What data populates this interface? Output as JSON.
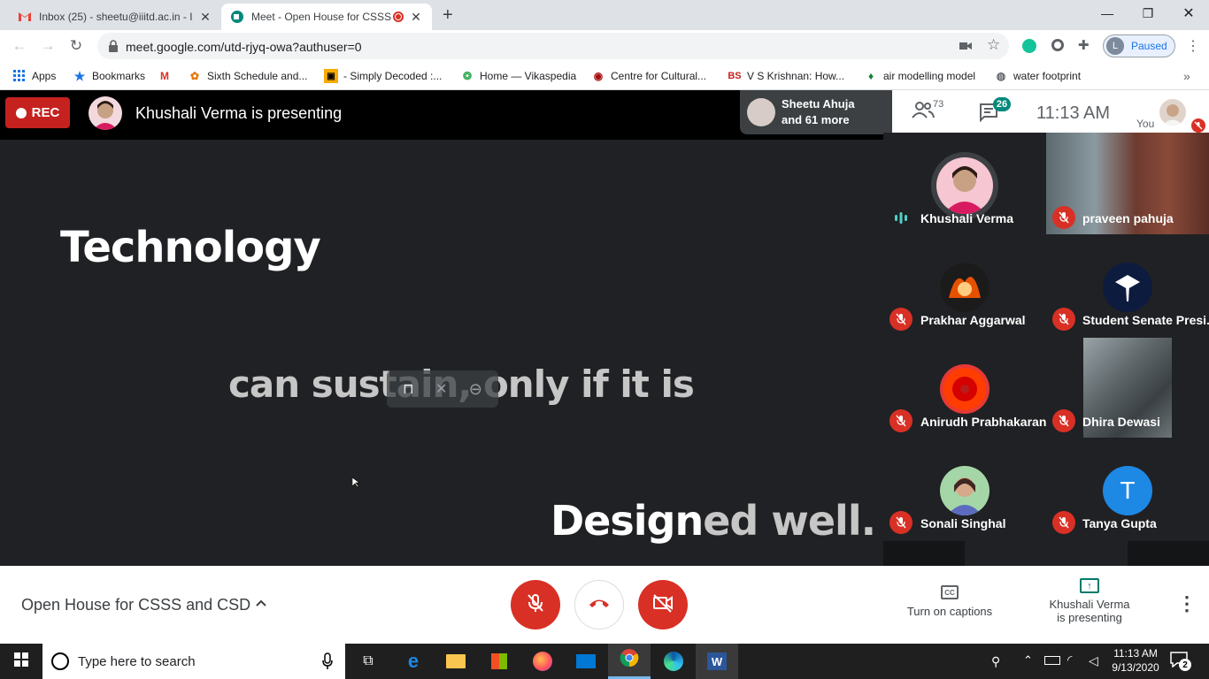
{
  "browser": {
    "tabs": [
      {
        "title": "Inbox (25) - sheetu@iiitd.ac.in - I"
      },
      {
        "title": "Meet - Open House for CSSS"
      }
    ],
    "new_tab": "+",
    "url": "meet.google.com/utd-rjyq-owa?authuser=0",
    "profile_status": "Paused",
    "profile_initial": "L",
    "bookmarks": [
      {
        "label": "Apps"
      },
      {
        "label": "Bookmarks"
      },
      {
        "label": "Sixth Schedule and..."
      },
      {
        "label": "- Simply Decoded :..."
      },
      {
        "label": "Home — Vikaspedia"
      },
      {
        "label": "Centre for Cultural..."
      },
      {
        "label": "V S Krishnan: How..."
      },
      {
        "label": "air modelling model"
      },
      {
        "label": "water footprint"
      }
    ],
    "bookmark_more": "»"
  },
  "meet": {
    "rec_label": "REC",
    "presenter_banner": "Khushali Verma is presenting",
    "joiners": {
      "line1": "Sheetu Ahuja",
      "line2": "and 61 more"
    },
    "participants_count": "73",
    "chat_count": "26",
    "time": "11:13 AM",
    "you_label": "You",
    "slide": {
      "word1": "Technology",
      "line2": "can sustain, only if it is",
      "line3a": "Design",
      "line3b": "ed well."
    },
    "participants": [
      {
        "name": "Khushali Verma",
        "initial": "",
        "color": "#c2185b"
      },
      {
        "name": "praveen pahuja",
        "initial": "",
        "color": "#6d4c41"
      },
      {
        "name": "Prakhar Aggarwal",
        "initial": "",
        "color": "#bf360c"
      },
      {
        "name": "Student Senate Presi...",
        "initial": "",
        "color": "#1a237e"
      },
      {
        "name": "Anirudh Prabhakaran",
        "initial": "",
        "color": "#e53935"
      },
      {
        "name": "Dhira Dewasi",
        "initial": "",
        "color": "#546e7a"
      },
      {
        "name": "Sonali Singhal",
        "initial": "",
        "color": "#8d6e63"
      },
      {
        "name": "Tanya Gupta",
        "initial": "T",
        "color": "#1e88e5"
      }
    ],
    "meeting_title": "Open House for CSSS and CSD",
    "captions_label": "Turn on captions",
    "presenting_label": {
      "line1": "Khushali Verma",
      "line2": "is presenting"
    },
    "colors": {
      "red": "#d93025",
      "rec": "#c5221f",
      "stage": "#202124"
    }
  },
  "taskbar": {
    "search_placeholder": "Type here to search",
    "time": "11:13 AM",
    "date": "9/13/2020",
    "notifications": "2"
  }
}
